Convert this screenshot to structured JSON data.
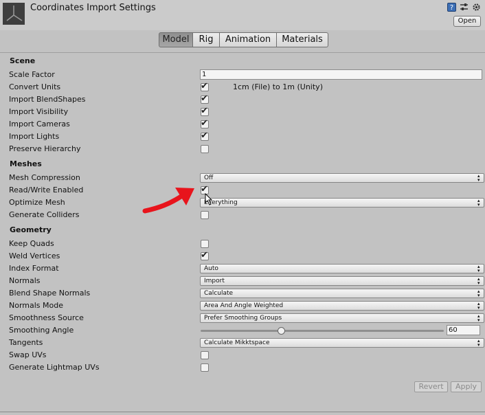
{
  "header": {
    "title": "Coordinates Import Settings",
    "help_glyph": "?",
    "open_label": "Open"
  },
  "tabs": [
    {
      "label": "Model",
      "active": true
    },
    {
      "label": "Rig",
      "active": false
    },
    {
      "label": "Animation",
      "active": false
    },
    {
      "label": "Materials",
      "active": false
    }
  ],
  "scene": {
    "heading": "Scene",
    "scale_factor": {
      "label": "Scale Factor",
      "value": "1"
    },
    "convert_units": {
      "label": "Convert Units",
      "checked": true,
      "note": "1cm (File) to 1m (Unity)"
    },
    "import_blendshapes": {
      "label": "Import BlendShapes",
      "checked": true
    },
    "import_visibility": {
      "label": "Import Visibility",
      "checked": true
    },
    "import_cameras": {
      "label": "Import Cameras",
      "checked": true
    },
    "import_lights": {
      "label": "Import Lights",
      "checked": true
    },
    "preserve_hierarchy": {
      "label": "Preserve Hierarchy",
      "checked": false
    }
  },
  "meshes": {
    "heading": "Meshes",
    "mesh_compression": {
      "label": "Mesh Compression",
      "value": "Off"
    },
    "read_write": {
      "label": "Read/Write Enabled",
      "checked": true
    },
    "optimize_mesh": {
      "label": "Optimize Mesh",
      "value": "Everything"
    },
    "generate_colliders": {
      "label": "Generate Colliders",
      "checked": false
    }
  },
  "geometry": {
    "heading": "Geometry",
    "keep_quads": {
      "label": "Keep Quads",
      "checked": false
    },
    "weld_vertices": {
      "label": "Weld Vertices",
      "checked": true
    },
    "index_format": {
      "label": "Index Format",
      "value": "Auto"
    },
    "normals": {
      "label": "Normals",
      "value": "Import"
    },
    "blend_shape_normals": {
      "label": "Blend Shape Normals",
      "value": "Calculate"
    },
    "normals_mode": {
      "label": "Normals Mode",
      "value": "Area And Angle Weighted"
    },
    "smoothness_source": {
      "label": "Smoothness Source",
      "value": "Prefer Smoothing Groups"
    },
    "smoothing_angle": {
      "label": "Smoothing Angle",
      "value": "60",
      "fraction": 0.333
    },
    "tangents": {
      "label": "Tangents",
      "value": "Calculate Mikktspace"
    },
    "swap_uvs": {
      "label": "Swap UVs",
      "checked": false
    },
    "generate_lightmap_uvs": {
      "label": "Generate Lightmap UVs",
      "checked": false
    }
  },
  "footer": {
    "revert_label": "Revert",
    "apply_label": "Apply"
  },
  "colors": {
    "annotation_arrow": "#e8141c",
    "background": "#c2c2c2"
  }
}
